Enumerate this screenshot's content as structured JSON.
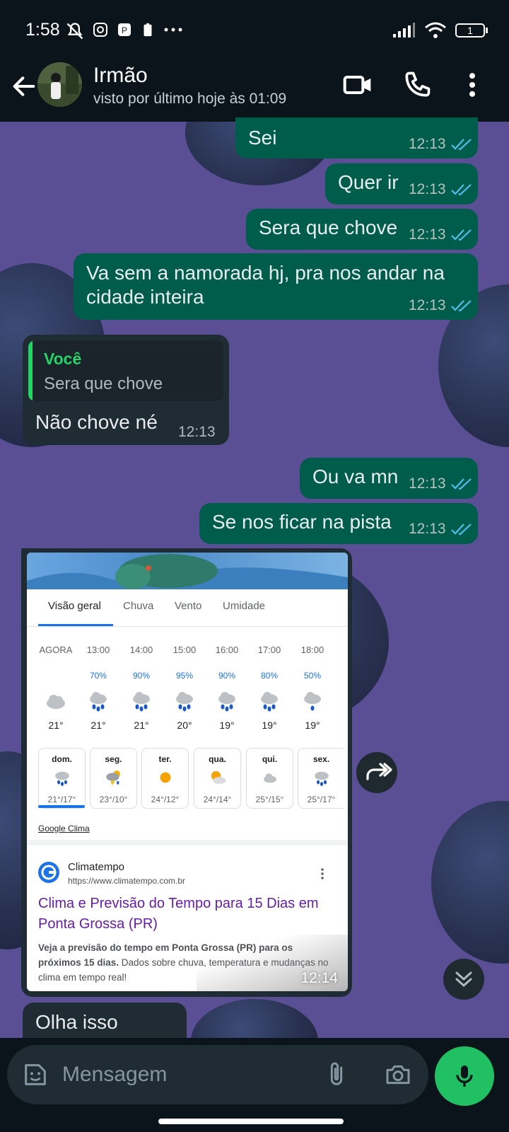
{
  "status_bar": {
    "time": "1:58",
    "battery": "1"
  },
  "header": {
    "contact_name": "Irmão",
    "last_seen": "visto por último hoje às 01:09",
    "icons": [
      "back-arrow-icon",
      "video-call-icon",
      "phone-icon",
      "more-vert-icon"
    ]
  },
  "messages": [
    {
      "text": "Sei",
      "time": "12:13"
    },
    {
      "text": "Quer ir",
      "time": "12:13"
    },
    {
      "text": "Sera que chove",
      "time": "12:13"
    },
    {
      "text": "Va sem a namorada hj, pra nos andar na",
      "text2": "cidade inteira",
      "time": "12:13"
    },
    {
      "quote_author": "Você",
      "quote_text": "Sera que chove",
      "text": "Não chove né",
      "time": "12:13"
    },
    {
      "text": "Ou va mn",
      "time": "12:13"
    },
    {
      "text": "Se nos ficar na pista",
      "time": "12:13"
    },
    {
      "time": "12:14"
    },
    {
      "text": "Olha isso"
    }
  ],
  "weather_card": {
    "tabs": [
      "Visão geral",
      "Chuva",
      "Vento",
      "Umidade"
    ],
    "hours": [
      {
        "label": "AGORA",
        "pct": "",
        "temp": "21°",
        "icon": "cloud-icon"
      },
      {
        "label": "13:00",
        "pct": "70%",
        "temp": "21°",
        "icon": "rain-icon"
      },
      {
        "label": "14:00",
        "pct": "90%",
        "temp": "21°",
        "icon": "rain-icon"
      },
      {
        "label": "15:00",
        "pct": "95%",
        "temp": "20°",
        "icon": "rain-icon"
      },
      {
        "label": "16:00",
        "pct": "90%",
        "temp": "19°",
        "icon": "rain-icon"
      },
      {
        "label": "17:00",
        "pct": "80%",
        "temp": "19°",
        "icon": "rain-icon"
      },
      {
        "label": "18:00",
        "pct": "50%",
        "temp": "19°",
        "icon": "rain-icon"
      }
    ],
    "days": [
      {
        "name": "dom.",
        "temp": "21°/17°",
        "icon": "rain-icon"
      },
      {
        "name": "seg.",
        "temp": "23°/10°",
        "icon": "thunderstorm-icon"
      },
      {
        "name": "ter.",
        "temp": "24°/12°",
        "icon": "sun-icon"
      },
      {
        "name": "qua.",
        "temp": "24°/14°",
        "icon": "partly-cloudy-icon"
      },
      {
        "name": "qui.",
        "temp": "25°/15°",
        "icon": "cloud-icon"
      },
      {
        "name": "sex.",
        "temp": "25°/17°",
        "icon": "rain-icon"
      }
    ],
    "source_link": "Google Clima",
    "result": {
      "site_name": "Climatempo",
      "url": "https://www.climatempo.com.br",
      "title": "Clima e Previsão do Tempo para 15 Dias em Ponta Grossa (PR)",
      "snippet_bold": "Veja a previsão do tempo em Ponta Grossa (PR) para os próximos 15 dias.",
      "snippet_rest": " Dados sobre chuva, temperatura e mudanças no clima em tempo real!"
    }
  },
  "composer": {
    "placeholder": "Mensagem"
  },
  "colors": {
    "bg_chat": "#5a4e94",
    "bubble_out": "#005c4b",
    "bubble_in": "#202c33",
    "accent": "#25d366",
    "tick_read": "#53bdeb"
  }
}
